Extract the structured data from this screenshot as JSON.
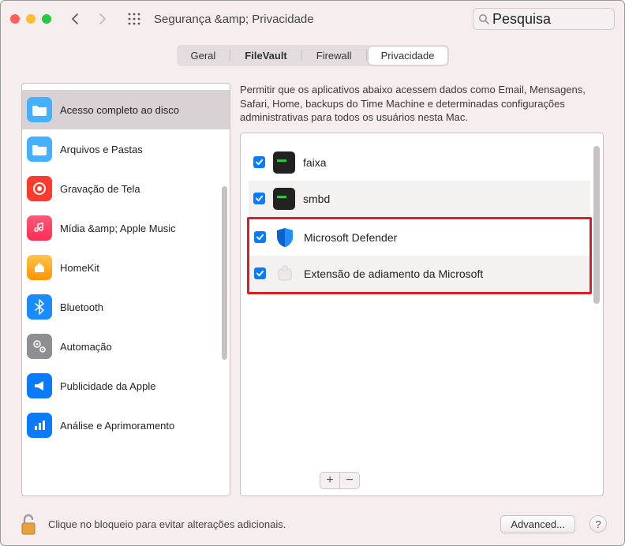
{
  "window": {
    "title": "Segurança &amp; Privacidade"
  },
  "search": {
    "placeholder": "Pesquisa"
  },
  "tabs": {
    "general": "Geral",
    "filevault": "FileVault",
    "firewall": "Firewall",
    "privacy": "Privacidade"
  },
  "sidebar": {
    "items": [
      {
        "label": "Acesso completo ao disco",
        "icon": "folder",
        "color": "#4da6ff"
      },
      {
        "label": "Arquivos e Pastas",
        "icon": "folder",
        "color": "#4da6ff"
      },
      {
        "label": "Gravação de Tela",
        "icon": "record",
        "color": "#ff3830"
      },
      {
        "label": "Mídia &amp; Apple Music",
        "icon": "music",
        "color": "#ff2d55"
      },
      {
        "label": "HomeKit",
        "icon": "home",
        "color": "#ffb300"
      },
      {
        "label": "Bluetooth",
        "icon": "bluetooth",
        "color": "#1a8cff"
      },
      {
        "label": "Automação",
        "icon": "gears",
        "color": "#8e8e93"
      },
      {
        "label": "Publicidade da Apple",
        "icon": "megaphone",
        "color": "#0a7aff"
      },
      {
        "label": "Análise e Aprimoramento",
        "icon": "chart",
        "color": "#0a7aff"
      }
    ]
  },
  "content": {
    "description": "Permitir que os aplicativos abaixo acessem dados como Email, Mensagens, Safari, Home, backups do Time Machine e determinadas configurações administrativas para todos os usuários nesta Mac.",
    "apps": [
      {
        "label": "faixa",
        "checked": true,
        "icon": "terminal"
      },
      {
        "label": "smbd",
        "checked": true,
        "icon": "terminal"
      },
      {
        "label": "Microsoft Defender",
        "checked": true,
        "icon": "shield"
      },
      {
        "label": "Extensão de adiamento da Microsoft",
        "checked": true,
        "icon": "extension"
      }
    ]
  },
  "footer": {
    "lock_text": "Clique no bloqueio para evitar alterações adicionais.",
    "advanced": "Advanced...",
    "help": "?"
  }
}
